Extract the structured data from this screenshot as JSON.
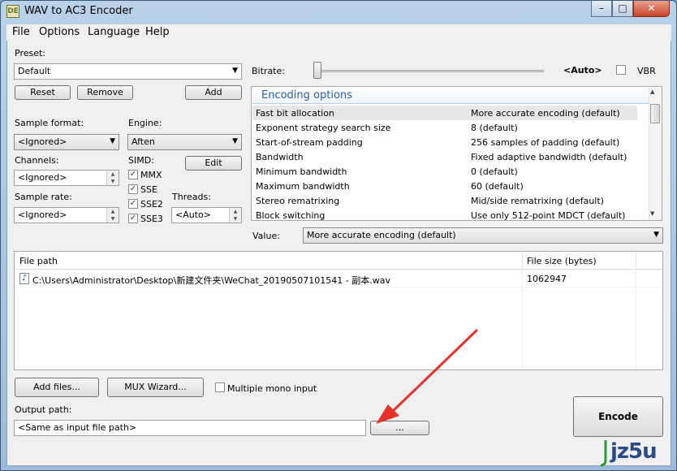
{
  "window": {
    "title": "WAV to AC3 Encoder",
    "icon_text": "DE",
    "minimize": "–",
    "maximize": "□",
    "close": "✕"
  },
  "menu": [
    "File",
    "Options",
    "Language",
    "Help"
  ],
  "preset": {
    "label": "Preset:",
    "value": "Default",
    "reset": "Reset",
    "remove": "Remove",
    "add": "Add"
  },
  "bitrate": {
    "label": "Bitrate:",
    "value": "<Auto>",
    "vbr_label": "VBR",
    "slider_level": 0
  },
  "sample_format": {
    "label": "Sample format:",
    "value": "<Ignored>"
  },
  "engine": {
    "label": "Engine:",
    "value": "Aften"
  },
  "channels": {
    "label": "Channels:",
    "value": "<Ignored>"
  },
  "simd": {
    "label": "SIMD:",
    "edit": "Edit",
    "options": [
      {
        "label": "MMX",
        "checked": true
      },
      {
        "label": "SSE",
        "checked": true
      },
      {
        "label": "SSE2",
        "checked": true
      },
      {
        "label": "SSE3",
        "checked": true
      }
    ]
  },
  "sample_rate": {
    "label": "Sample rate:",
    "value": "<Ignored>"
  },
  "threads": {
    "label": "Threads:",
    "value": "<Auto>"
  },
  "encoding_options": {
    "title": "Encoding options",
    "rows": [
      {
        "name": "Fast bit allocation",
        "value": "More accurate encoding (default)"
      },
      {
        "name": "Exponent strategy search size",
        "value": "8 (default)"
      },
      {
        "name": "Start-of-stream padding",
        "value": "256 samples of padding (default)"
      },
      {
        "name": "Bandwidth",
        "value": "Fixed adaptive bandwidth (default)"
      },
      {
        "name": "Minimum bandwidth",
        "value": "0 (default)"
      },
      {
        "name": "Maximum bandwidth",
        "value": "60 (default)"
      },
      {
        "name": "Stereo rematrixing",
        "value": "Mid/side rematrixing (default)"
      },
      {
        "name": "Block switching",
        "value": "Use only 512-point MDCT (default)"
      }
    ]
  },
  "value": {
    "label": "Value:",
    "selected": "More accurate encoding (default)"
  },
  "file_list": {
    "headers": [
      "File path",
      "File size (bytes)"
    ],
    "rows": [
      {
        "path": "C:\\Users\\Administrator\\Desktop\\新建文件夹\\WeChat_20190507101541 - 副本.wav",
        "size": "1062947"
      }
    ]
  },
  "add_files": "Add files...",
  "mux_wizard": "MUX Wizard...",
  "multiple_mono": "Multiple mono input",
  "output": {
    "label": "Output path:",
    "value": "<Same as input file path>",
    "browse": "..."
  },
  "encode": "Encode",
  "watermark": "jz5u",
  "colors": {
    "annotation_arrow": "#e8312a",
    "accent": "#2a5fae"
  }
}
